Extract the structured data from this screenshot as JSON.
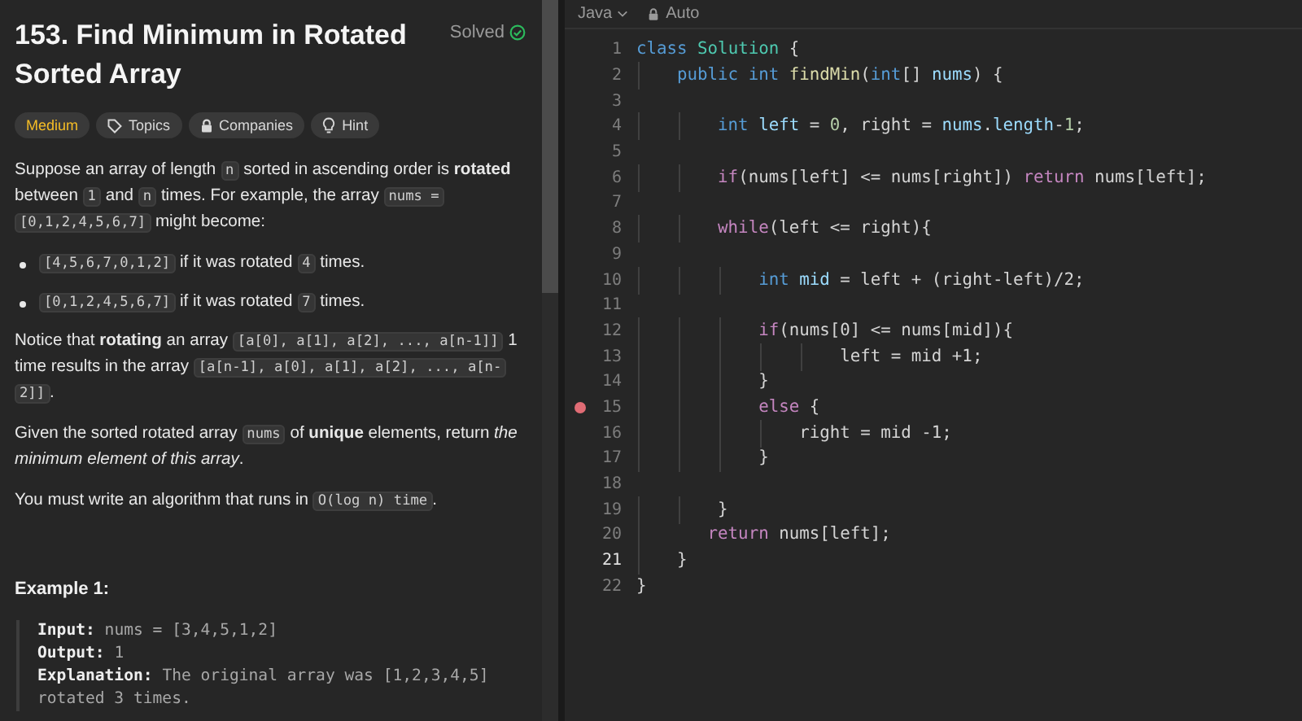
{
  "problem": {
    "title": "153. Find Minimum in Rotated Sorted Array",
    "status": "Solved",
    "solved": true
  },
  "tags": [
    {
      "kind": "difficulty",
      "label": "Medium"
    },
    {
      "kind": "topics",
      "label": "Topics"
    },
    {
      "kind": "companies",
      "label": "Companies"
    },
    {
      "kind": "hint",
      "label": "Hint"
    }
  ],
  "description": [
    {
      "kind": "paragraph",
      "segments": [
        {
          "kind": "text",
          "text": "Suppose an array of length "
        },
        {
          "kind": "code",
          "text": "n"
        },
        {
          "kind": "text",
          "text": " sorted in ascending order is **rotated** between "
        },
        {
          "kind": "code",
          "text": "1"
        },
        {
          "kind": "text",
          "text": " and "
        },
        {
          "kind": "code",
          "text": "n"
        },
        {
          "kind": "text",
          "text": " times. For example, the array "
        },
        {
          "kind": "code",
          "text": "nums = [0,1,2,4,5,6,7]"
        },
        {
          "kind": "text",
          "text": " might become:"
        }
      ]
    },
    {
      "kind": "bullet",
      "segments": [
        {
          "kind": "code",
          "text": "[4,5,6,7,0,1,2]"
        },
        {
          "kind": "text",
          "text": " if it was rotated "
        },
        {
          "kind": "code",
          "text": "4"
        },
        {
          "kind": "text",
          "text": " times."
        }
      ]
    },
    {
      "kind": "bullet",
      "segments": [
        {
          "kind": "code",
          "text": "[0,1,2,4,5,6,7]"
        },
        {
          "kind": "text",
          "text": " if it was rotated "
        },
        {
          "kind": "code",
          "text": "7"
        },
        {
          "kind": "text",
          "text": " times."
        }
      ]
    },
    {
      "kind": "paragraph",
      "segments": [
        {
          "kind": "text",
          "text": "Notice that **rotating** an array "
        },
        {
          "kind": "code",
          "text": "[a[0], a[1], a[2], ..., a[n-1]]"
        },
        {
          "kind": "text",
          "text": " 1 time results in the array "
        },
        {
          "kind": "code",
          "text": "[a[n-1], a[0], a[1], a[2], ..., a[n-2]]"
        },
        {
          "kind": "text",
          "text": "."
        }
      ]
    },
    {
      "kind": "paragraph",
      "segments": [
        {
          "kind": "text",
          "text": "Given the sorted rotated array "
        },
        {
          "kind": "code",
          "text": "nums"
        },
        {
          "kind": "text",
          "text": " of **unique** elements, return *the minimum element of this array*."
        }
      ]
    },
    {
      "kind": "paragraph",
      "segments": [
        {
          "kind": "text",
          "text": "You must write an algorithm that runs in "
        },
        {
          "kind": "code",
          "text": "O(log n) time"
        },
        {
          "kind": "text",
          "text": "."
        }
      ]
    }
  ],
  "example": {
    "title": "Example 1:",
    "lines": [
      {
        "label": "Input:",
        "value": "nums = [3,4,5,1,2]"
      },
      {
        "label": "Output:",
        "value": "1"
      },
      {
        "label": "Explanation:",
        "value": "The original array was [1,2,3,4,5] rotated 3 times."
      }
    ]
  },
  "editor": {
    "language": "Java",
    "mode": "Auto",
    "lines": [
      {
        "number": "1",
        "current": false,
        "breakpoint": false,
        "tokens": [
          {
            "kind": "storage",
            "text": "class "
          },
          {
            "kind": "type",
            "text": "Solution"
          },
          {
            "kind": "plain",
            "text": " {"
          }
        ]
      },
      {
        "number": "2",
        "current": false,
        "breakpoint": false,
        "tokens": [
          {
            "kind": "storage",
            "text": "    public int "
          },
          {
            "kind": "function",
            "text": "findMin"
          },
          {
            "kind": "plain",
            "text": "("
          },
          {
            "kind": "storage",
            "text": "int"
          },
          {
            "kind": "plain",
            "text": "[] "
          },
          {
            "kind": "variable",
            "text": "nums"
          },
          {
            "kind": "plain",
            "text": ") {"
          }
        ]
      },
      {
        "number": "3",
        "current": false,
        "breakpoint": false
      },
      {
        "number": "4",
        "current": false,
        "breakpoint": false,
        "tokens": [
          {
            "kind": "storage",
            "text": "        int "
          },
          {
            "kind": "variable",
            "text": "left"
          },
          {
            "kind": "plain",
            "text": " = "
          },
          {
            "kind": "number",
            "text": "0"
          },
          {
            "kind": "plain",
            "text": ", right = "
          },
          {
            "kind": "variable",
            "text": "nums"
          },
          {
            "kind": "plain",
            "text": "."
          },
          {
            "kind": "variable",
            "text": "length"
          },
          {
            "kind": "plain",
            "text": "-"
          },
          {
            "kind": "number",
            "text": "1"
          },
          {
            "kind": "plain",
            "text": ";"
          }
        ]
      },
      {
        "number": "5",
        "current": false,
        "breakpoint": false
      },
      {
        "number": "6",
        "current": false,
        "breakpoint": false,
        "tokens": [
          {
            "kind": "keyword",
            "text": "        if"
          },
          {
            "kind": "plain",
            "text": "(nums[left] <= nums[right]) "
          },
          {
            "kind": "keyword",
            "text": "return"
          },
          {
            "kind": "plain",
            "text": " nums[left];"
          }
        ]
      },
      {
        "number": "7",
        "current": false,
        "breakpoint": false
      },
      {
        "number": "8",
        "current": false,
        "breakpoint": false,
        "tokens": [
          {
            "kind": "keyword",
            "text": "        while"
          },
          {
            "kind": "plain",
            "text": "(left <= right){"
          }
        ]
      },
      {
        "number": "9",
        "current": false,
        "breakpoint": false
      },
      {
        "number": "10",
        "current": false,
        "breakpoint": false,
        "tokens": [
          {
            "kind": "storage",
            "text": "            int "
          },
          {
            "kind": "variable",
            "text": "mid"
          },
          {
            "kind": "plain",
            "text": " = left + (right-left)/2;"
          }
        ]
      },
      {
        "number": "11",
        "current": false,
        "breakpoint": false
      },
      {
        "number": "12",
        "current": false,
        "breakpoint": false,
        "tokens": [
          {
            "kind": "keyword",
            "text": "            if"
          },
          {
            "kind": "plain",
            "text": "(nums[0] <= nums[mid]){"
          }
        ]
      },
      {
        "number": "13",
        "current": false,
        "breakpoint": false,
        "tokens": [
          {
            "kind": "plain",
            "text": "                    left = mid +1;"
          }
        ]
      },
      {
        "number": "14",
        "current": false,
        "breakpoint": false,
        "tokens": [
          {
            "kind": "plain",
            "text": "            }"
          }
        ]
      },
      {
        "number": "15",
        "current": false,
        "breakpoint": true,
        "tokens": [
          {
            "kind": "keyword",
            "text": "            else"
          },
          {
            "kind": "plain",
            "text": " {"
          }
        ]
      },
      {
        "number": "16",
        "current": false,
        "breakpoint": false,
        "tokens": [
          {
            "kind": "plain",
            "text": "                right = mid -1;"
          }
        ]
      },
      {
        "number": "17",
        "current": false,
        "breakpoint": false,
        "tokens": [
          {
            "kind": "plain",
            "text": "            }"
          }
        ]
      },
      {
        "number": "18",
        "current": false,
        "breakpoint": false
      },
      {
        "number": "19",
        "current": false,
        "breakpoint": false,
        "tokens": [
          {
            "kind": "plain",
            "text": "        }"
          }
        ]
      },
      {
        "number": "20",
        "current": false,
        "breakpoint": false,
        "tokens": [
          {
            "kind": "keyword",
            "text": "       return"
          },
          {
            "kind": "plain",
            "text": " nums[left];"
          }
        ]
      },
      {
        "number": "21",
        "current": true,
        "breakpoint": false,
        "tokens": [
          {
            "kind": "plain",
            "text": "    }"
          }
        ]
      },
      {
        "number": "22",
        "current": false,
        "breakpoint": false,
        "tokens": [
          {
            "kind": "plain",
            "text": "}"
          }
        ]
      }
    ]
  }
}
